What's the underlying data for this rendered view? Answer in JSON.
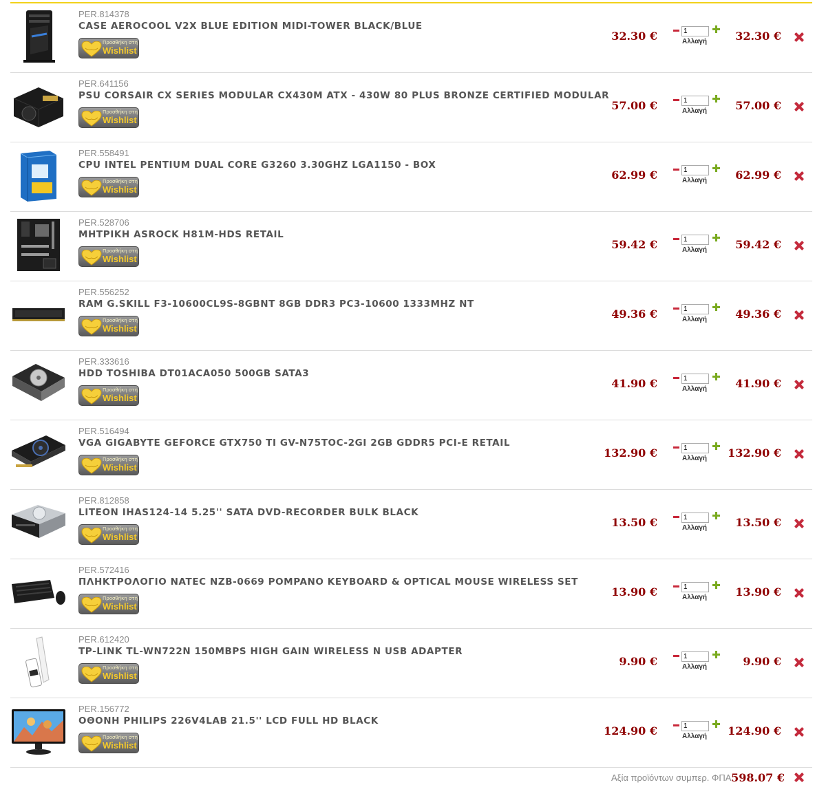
{
  "cart": {
    "wishlist_small": "Προσθήκη στη",
    "wishlist_big": "Wishlist",
    "change_label": "Αλλαγή",
    "currency": "€",
    "items": [
      {
        "code": "PER.814378",
        "name": "CASE AEROCOOL V2X BLUE EDITION MIDI-TOWER BLACK/BLUE",
        "unit_price": "32.30 €",
        "qty": "1",
        "total": "32.30 €",
        "icon": "pc-case-icon"
      },
      {
        "code": "PER.641156",
        "name": "PSU CORSAIR CX SERIES MODULAR CX430M ATX - 430W 80 PLUS BRONZE CERTIFIED MODULAR",
        "unit_price": "57.00 €",
        "qty": "1",
        "total": "57.00 €",
        "icon": "power-supply-icon"
      },
      {
        "code": "PER.558491",
        "name": "CPU INTEL PENTIUM DUAL CORE G3260 3.30GHZ LGA1150 - BOX",
        "unit_price": "62.99 €",
        "qty": "1",
        "total": "62.99 €",
        "icon": "cpu-box-icon"
      },
      {
        "code": "PER.528706",
        "name": "ΜΗΤΡΙΚΗ ASROCK H81M-HDS RETAIL",
        "unit_price": "59.42 €",
        "qty": "1",
        "total": "59.42 €",
        "icon": "motherboard-icon"
      },
      {
        "code": "PER.556252",
        "name": "RAM G.SKILL F3-10600CL9S-8GBNT 8GB DDR3 PC3-10600 1333MHZ NT",
        "unit_price": "49.36 €",
        "qty": "1",
        "total": "49.36 €",
        "icon": "ram-module-icon"
      },
      {
        "code": "PER.333616",
        "name": "HDD TOSHIBA DT01ACA050 500GB SATA3",
        "unit_price": "41.90 €",
        "qty": "1",
        "total": "41.90 €",
        "icon": "hard-drive-icon"
      },
      {
        "code": "PER.516494",
        "name": "VGA GIGABYTE GEFORCE GTX750 TI GV-N75TOC-2GI 2GB GDDR5 PCI-E RETAIL",
        "unit_price": "132.90 €",
        "qty": "1",
        "total": "132.90 €",
        "icon": "graphics-card-icon"
      },
      {
        "code": "PER.812858",
        "name": "LITEON IHAS124-14 5.25'' SATA DVD-RECORDER BULK BLACK",
        "unit_price": "13.50 €",
        "qty": "1",
        "total": "13.50 €",
        "icon": "dvd-drive-icon"
      },
      {
        "code": "PER.572416",
        "name": "ΠΛΗΚΤΡΟΛΟΓΙΟ NATEC NZB-0669 POMPANO KEYBOARD & OPTICAL MOUSE WIRELESS SET",
        "unit_price": "13.90 €",
        "qty": "1",
        "total": "13.90 €",
        "icon": "keyboard-mouse-icon"
      },
      {
        "code": "PER.612420",
        "name": "TP-LINK TL-WN722N 150MBPS HIGH GAIN WIRELESS N USB ADAPTER",
        "unit_price": "9.90 €",
        "qty": "1",
        "total": "9.90 €",
        "icon": "usb-wifi-adapter-icon"
      },
      {
        "code": "PER.156772",
        "name": "ΟΘΟΝΗ PHILIPS 226V4LAB 21.5'' LCD FULL HD BLACK",
        "unit_price": "124.90 €",
        "qty": "1",
        "total": "124.90 €",
        "icon": "monitor-icon"
      }
    ],
    "summary_label": "Αξία προϊόντων συμπερ. ΦΠΑ:",
    "summary_total": "598.07 €"
  },
  "colors": {
    "accent_line": "#f2d21b",
    "price": "#8f0000",
    "delete": "#c42a3c",
    "plus": "#7aaa1f"
  }
}
